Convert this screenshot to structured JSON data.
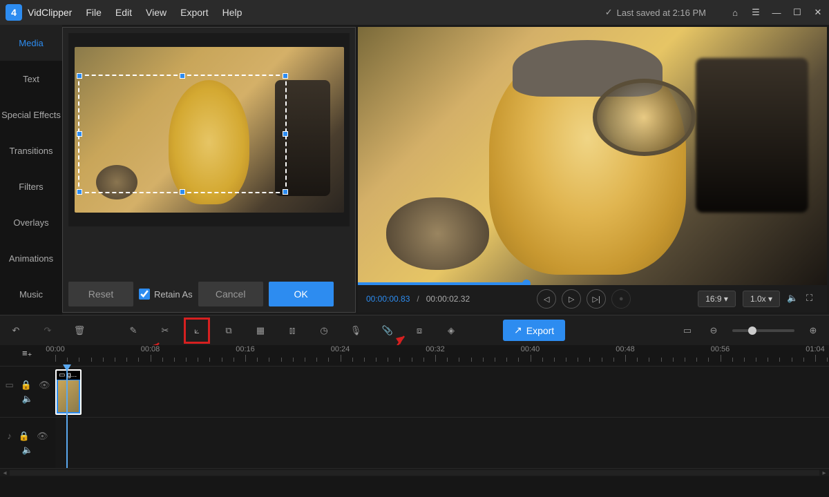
{
  "app": {
    "name": "VidClipper",
    "save_status": "Last saved at 2:16 PM"
  },
  "menu": [
    "File",
    "Edit",
    "View",
    "Export",
    "Help"
  ],
  "sidebar": {
    "items": [
      {
        "label": "Media"
      },
      {
        "label": "Text"
      },
      {
        "label": "Special Effects"
      },
      {
        "label": "Transitions"
      },
      {
        "label": "Filters"
      },
      {
        "label": "Overlays"
      },
      {
        "label": "Animations"
      },
      {
        "label": "Music"
      }
    ],
    "active": 0
  },
  "crop_panel": {
    "reset": "Reset",
    "retain_label": "Retain As",
    "retain_checked": true,
    "cancel": "Cancel",
    "ok": "OK"
  },
  "preview": {
    "current_time": "00:00:00.83",
    "total_time": "00:00:02.32",
    "aspect": "16:9",
    "speed": "1.0x"
  },
  "toolbar": {
    "export": "Export"
  },
  "timeline": {
    "marks": [
      "00:00",
      "00:08",
      "00:16",
      "00:24",
      "00:32",
      "00:40",
      "00:48",
      "00:56",
      "01:04"
    ],
    "clip_label": "g..."
  }
}
